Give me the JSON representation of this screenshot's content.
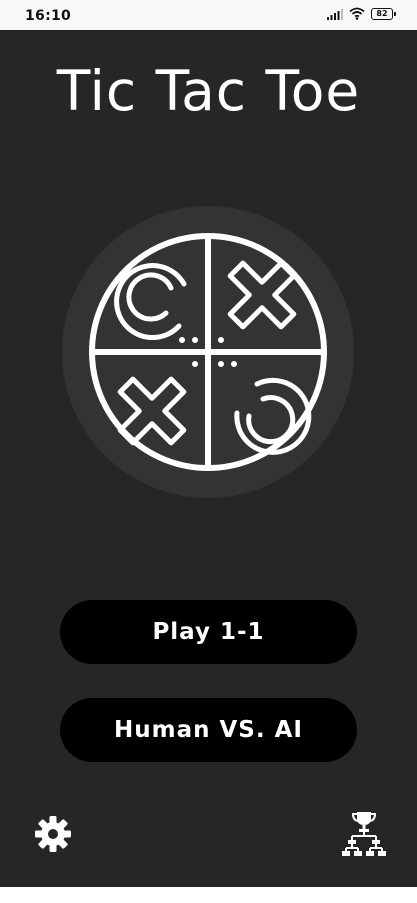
{
  "status_bar": {
    "time": "16:10",
    "battery_level": "82",
    "icons": [
      "signal-icon",
      "wifi-icon",
      "battery-icon"
    ]
  },
  "app": {
    "title": "Tic Tac Toe",
    "logo_icon": "tic-tac-toe-logo-icon",
    "buttons": {
      "play_1v1": "Play 1-1",
      "human_vs_ai": "Human VS. AI"
    },
    "bottom_icons": {
      "settings": "gear-icon",
      "leaderboard": "trophy-tournament-icon"
    }
  },
  "colors": {
    "background": "#262626",
    "logo_circle": "#333333",
    "button_bg": "#000000",
    "text": "#ffffff"
  }
}
